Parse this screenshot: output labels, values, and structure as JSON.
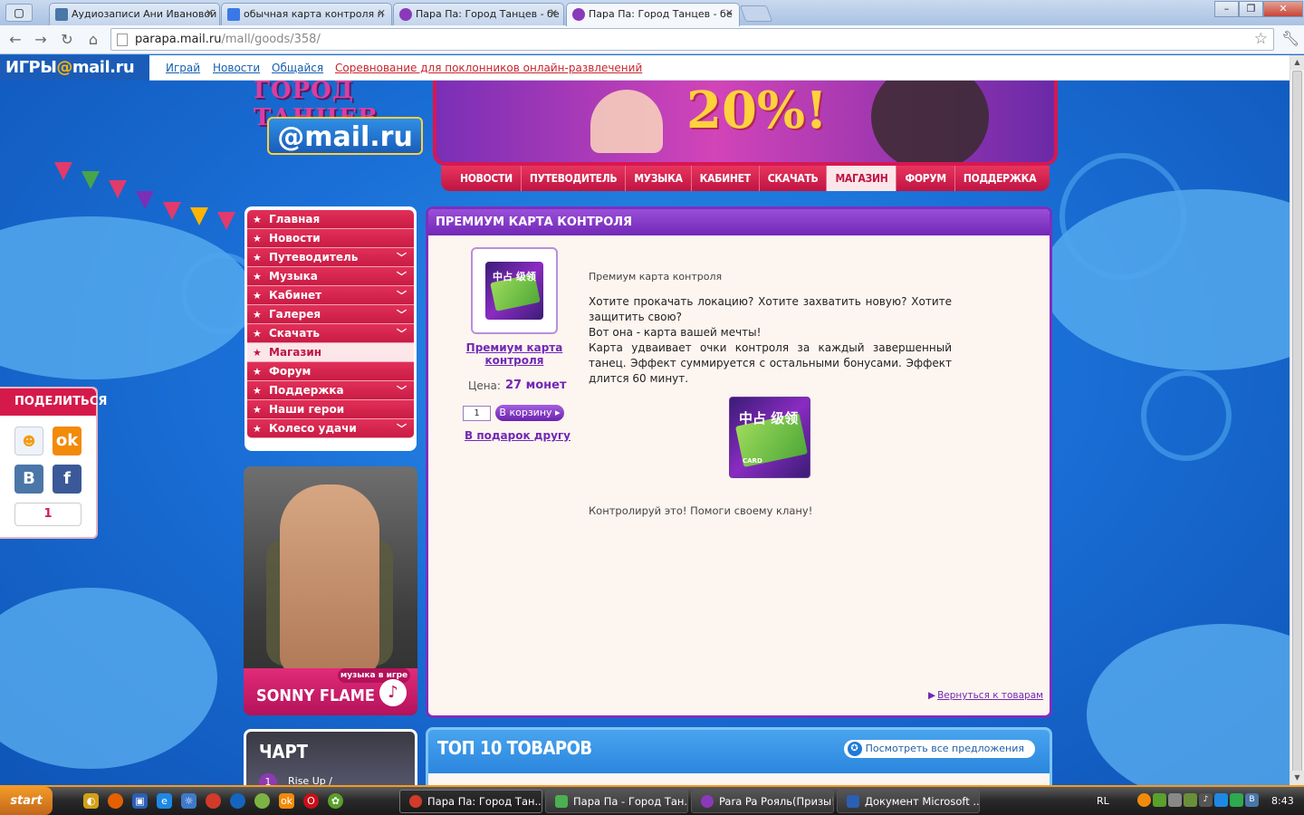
{
  "browser": {
    "tabs": [
      {
        "title": "Аудиозаписи Ани Ивановой",
        "icon_color": "#4a76a8"
      },
      {
        "title": "обычная карта контроля п",
        "icon_color": "#3b78e7"
      },
      {
        "title": "Пара Па: Город Танцев - бе",
        "icon_color": "#8a3ab8"
      },
      {
        "title": "Пара Па: Город Танцев - бе",
        "icon_color": "#8a3ab8"
      }
    ],
    "url_host": "parapa.mail.ru",
    "url_path": "/mall/goods/358/"
  },
  "mailbar": {
    "logo_prefix": "ИГРЫ",
    "logo_at": "@",
    "logo_suffix": "mail.ru",
    "links": [
      "Играй",
      "Новости",
      "Общайся"
    ],
    "promo_link": "Соревнование для поклонников онлайн-развлечений"
  },
  "game": {
    "logo_title": "ГОРОД ТАНЦЕВ",
    "logo_brand": "@mail.ru",
    "banner_promo": "20%!",
    "nav": [
      "НОВОСТИ",
      "ПУТЕВОДИТЕЛЬ",
      "МУЗЫКА",
      "КАБИНЕТ",
      "СКАЧАТЬ",
      "МАГАЗИН",
      "ФОРУМ",
      "ПОДДЕРЖКА"
    ],
    "nav_active": "МАГАЗИН"
  },
  "side_menu": [
    {
      "label": "Главная",
      "has_sub": false
    },
    {
      "label": "Новости",
      "has_sub": false
    },
    {
      "label": "Путеводитель",
      "has_sub": true
    },
    {
      "label": "Музыка",
      "has_sub": true
    },
    {
      "label": "Кабинет",
      "has_sub": true
    },
    {
      "label": "Галерея",
      "has_sub": true
    },
    {
      "label": "Скачать",
      "has_sub": true
    },
    {
      "label": "Магазин",
      "has_sub": false,
      "active": true
    },
    {
      "label": "Форум",
      "has_sub": false
    },
    {
      "label": "Поддержка",
      "has_sub": true
    },
    {
      "label": "Наши герои",
      "has_sub": false
    },
    {
      "label": "Колесо удачи",
      "has_sub": true
    }
  ],
  "artist_promo": {
    "tag": "музыка в игре",
    "name": "SONNY FLAME"
  },
  "chart_widget": {
    "title": "ЧАРТ",
    "first_rank": "1",
    "first_track": "Rise Up /"
  },
  "share": {
    "title": "ПОДЕЛИТЬСЯ",
    "count": "1"
  },
  "product": {
    "panel_title": "ПРЕМИУМ КАРТА КОНТРОЛЯ",
    "name_link": "Премиум карта контроля",
    "price_label": "Цена:",
    "price_value": "27 монет",
    "qty": "1",
    "cart_button": "В корзину",
    "gift_link": "В подарок другу",
    "desc_title": "Премиум карта контроля",
    "desc_lines": [
      "Хотите прокачать локацию? Хотите захватить новую? Хотите защитить свою?",
      "Вот она - карта вашей мечты!",
      "Карта удваивает очки контроля за каждый завершенный танец. Эффект суммируется с остальными бонусами. Эффект длится 60 минут."
    ],
    "card_text": "中占 级领",
    "card_label": "CARD",
    "desc_footer": "Контролируй это! Помоги своему клану!",
    "back_link": "Вернуться к товарам"
  },
  "top10": {
    "title": "ТОП 10 ТОВАРОВ",
    "see_all": "Посмотреть все предложения"
  },
  "taskbar": {
    "start_label": "start",
    "tasks": [
      {
        "label": "Пара Па: Город Тан...",
        "icon_color": "#d23a2a",
        "active": true
      },
      {
        "label": "Пара Па - Город Тан...",
        "icon_color": "#4caf50",
        "active": false
      },
      {
        "label": "Para Pa Рояль(Призы!)",
        "icon_color": "#8a3ab8",
        "active": false
      },
      {
        "label": "Документ Microsoft ...",
        "icon_color": "#2b5fb4",
        "active": false
      }
    ],
    "lang": "RL",
    "clock": "8:43"
  }
}
